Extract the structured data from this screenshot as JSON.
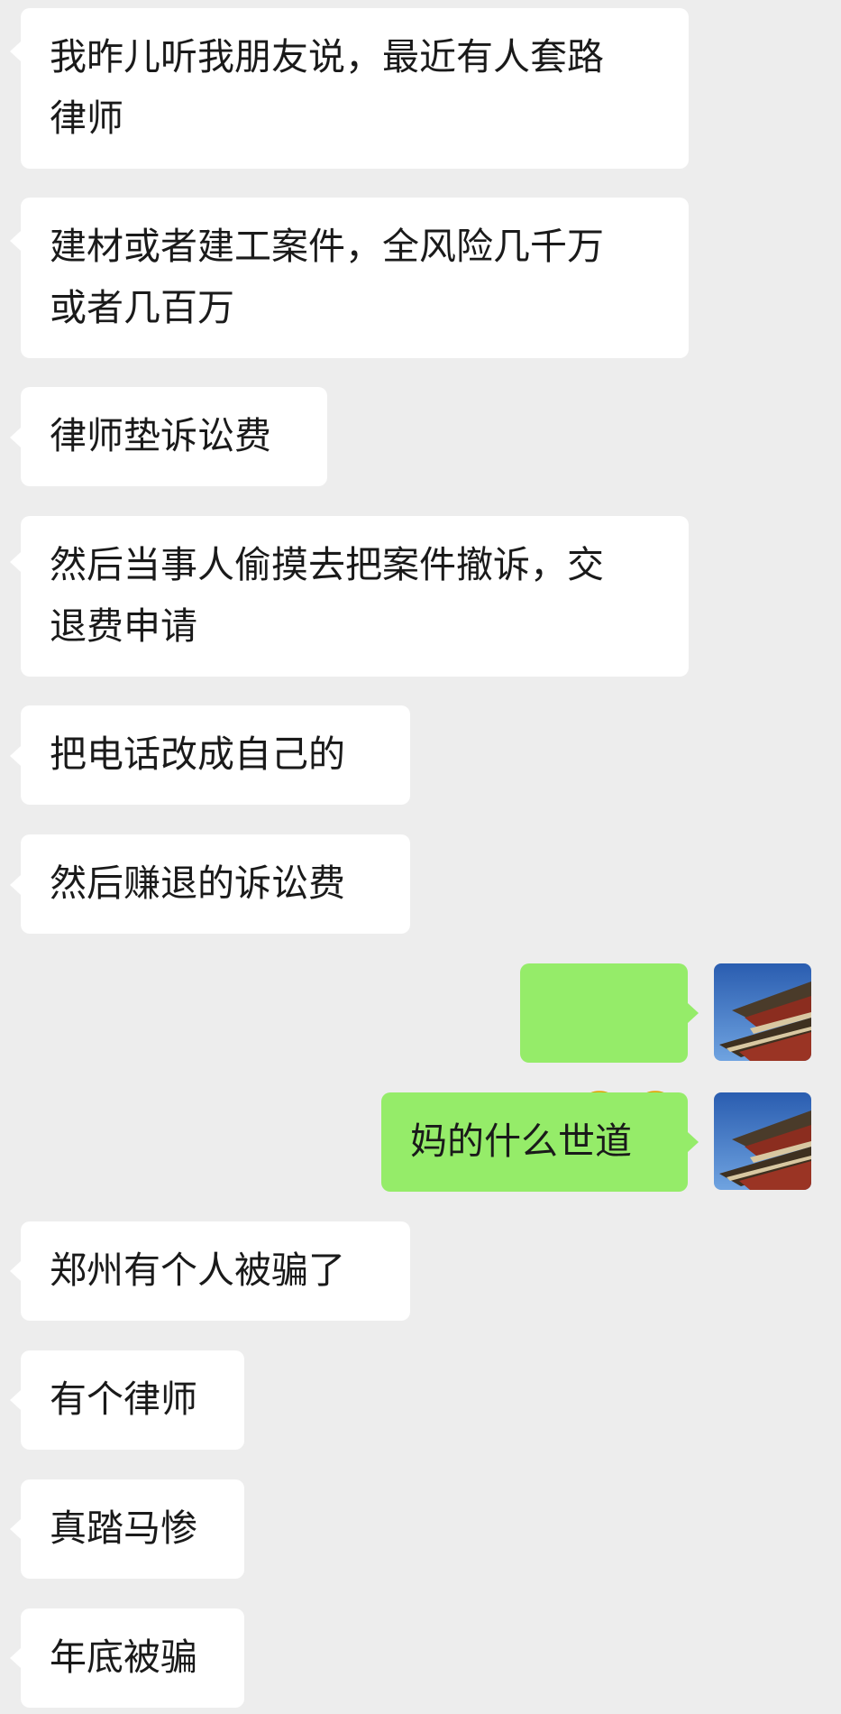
{
  "messages": [
    {
      "side": "in",
      "text": "我昨儿听我朋友说，最近有人套路\n律师"
    },
    {
      "side": "in",
      "text": "建材或者建工案件，全风险几千万\n或者几百万"
    },
    {
      "side": "in",
      "text": "律师垫诉讼费"
    },
    {
      "side": "in",
      "text": "然后当事人偷摸去把案件撤诉，交\n退费申请"
    },
    {
      "side": "in",
      "text": "把电话改成自己的"
    },
    {
      "side": "in",
      "text": "然后赚退的诉讼费"
    },
    {
      "side": "out",
      "emojis": [
        "face-with-tears-covering-face-icon",
        "face-with-tears-covering-face-icon"
      ]
    },
    {
      "side": "out",
      "text": "妈的什么世道"
    },
    {
      "side": "in",
      "text": "郑州有个人被骗了"
    },
    {
      "side": "in",
      "text": "有个律师"
    },
    {
      "side": "in",
      "text": "真踏马惨"
    },
    {
      "side": "in",
      "text": "年底被骗"
    }
  ],
  "colors": {
    "background": "#ededed",
    "incoming_bubble": "#ffffff",
    "outgoing_bubble": "#95ec69",
    "text": "#1a1a1a"
  },
  "avatar": {
    "icon": "pagoda-roof-photo-avatar"
  }
}
